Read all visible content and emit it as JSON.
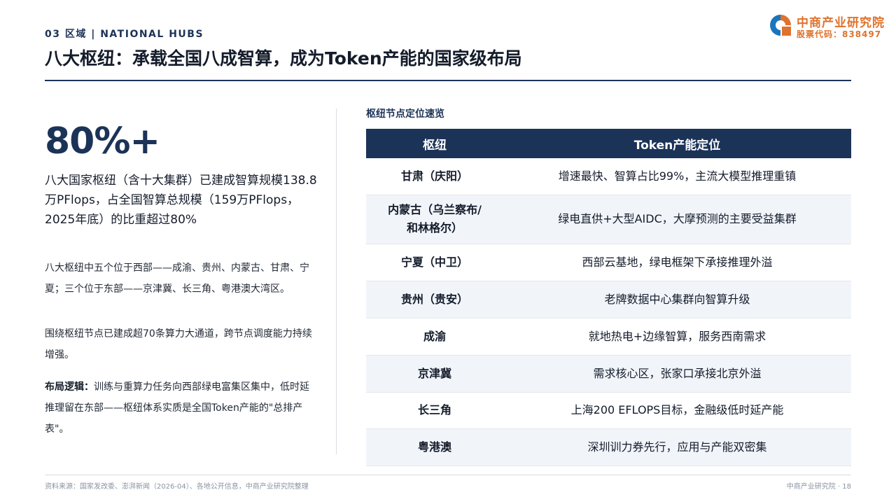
{
  "header": {
    "section_tag": "03 区域 | NATIONAL HUBS",
    "title": "八大枢纽：承载全国八成智算，成为Token产能的国家级布局"
  },
  "logo": {
    "name": "中商产业研究院",
    "stock_code": "股票代码：838497",
    "colors": {
      "orange": "#e0722c",
      "blue": "#1a75bc"
    }
  },
  "left": {
    "stat": "80%+",
    "stat_desc": "八大国家枢纽（含十大集群）已建成智算规模138.8万PFlops，占全国智算总规模（159万PFlops，2025年底）的比重超过80%",
    "para1": "八大枢纽中五个位于西部——成渝、贵州、内蒙古、甘肃、宁夏；三个位于东部——京津冀、长三角、粤港澳大湾区。",
    "para2": "围绕枢纽节点已建成超70条算力大通道，跨节点调度能力持续增强。",
    "para3_label": "布局逻辑：",
    "para3_text": "训练与重算力任务向西部绿电富集区集中，低时延推理留在东部——枢纽体系实质是全国Token产能的\"总排产表\"。"
  },
  "table": {
    "caption": "枢纽节点定位速览",
    "headers": [
      "枢纽",
      "Token产能定位"
    ],
    "rows": [
      {
        "hub": "甘肃（庆阳）",
        "role": "增速最快、智算占比99%，主流大模型推理重镇"
      },
      {
        "hub_line1": "内蒙古（乌兰察布/",
        "hub_line2": "和林格尔）",
        "role": "绿电直供+大型AIDC，大摩预测的主要受益集群"
      },
      {
        "hub": "宁夏（中卫）",
        "role": "西部云基地，绿电框架下承接推理外溢"
      },
      {
        "hub": "贵州（贵安）",
        "role": "老牌数据中心集群向智算升级"
      },
      {
        "hub": "成渝",
        "role": "就地热电+边缘智算，服务西南需求"
      },
      {
        "hub": "京津冀",
        "role": "需求核心区，张家口承接北京外溢"
      },
      {
        "hub": "长三角",
        "role": "上海200 EFLOPS目标，金融级低时延产能"
      },
      {
        "hub": "粤港澳",
        "role": "深圳训力券先行，应用与产能双密集"
      }
    ]
  },
  "footer": {
    "source": "资料来源：国家发改委、澎湃新闻（2026-04）、各地公开信息，中商产业研究院整理",
    "page": "中商产业研究院 · 18"
  },
  "colors": {
    "navy": "#1c3358",
    "row_alt": "#f1f5fa"
  }
}
